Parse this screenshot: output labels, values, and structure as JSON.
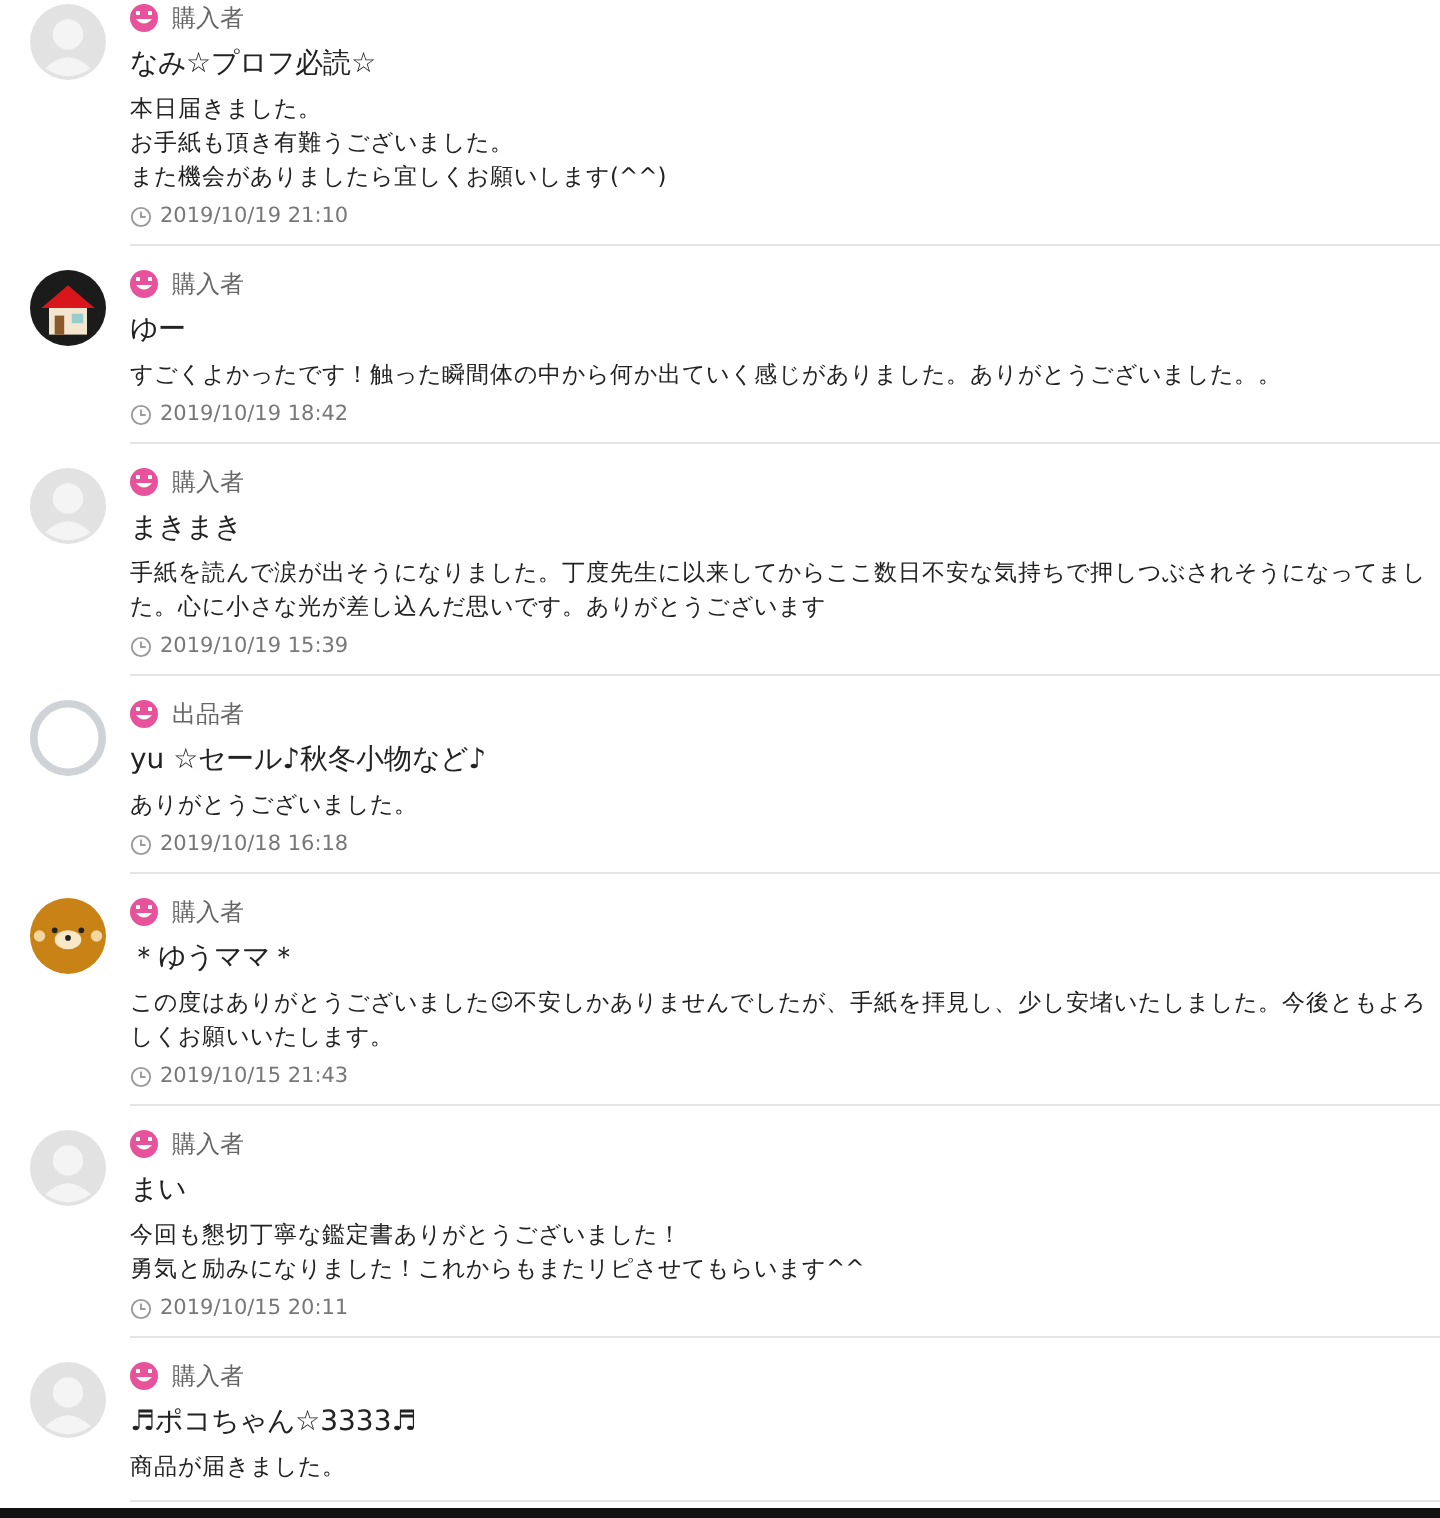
{
  "reviews": [
    {
      "kind": "default",
      "role": "購入者",
      "name": "なみ☆プロフ必読☆",
      "lines": [
        "本日届きました。",
        "お手紙も頂き有難うございました。",
        "また機会がありましたら宜しくお願いします(^^)"
      ],
      "time": "2019/10/19 21:10"
    },
    {
      "kind": "house",
      "role": "購入者",
      "name": "ゆー",
      "lines": [
        "すごくよかったです！触った瞬間体の中から何か出ていく感じがありました。ありがとうございました。。"
      ],
      "time": "2019/10/19 18:42"
    },
    {
      "kind": "default",
      "role": "購入者",
      "name": "まきまき",
      "lines": [
        "手紙を読んで涙が出そうになりました。丁度先生に以来してからここ数日不安な気持ちで押しつぶされそうになってました。心に小さな光が差し込んだ思いです。ありがとうございます"
      ],
      "time": "2019/10/19 15:39"
    },
    {
      "kind": "outline",
      "role": "出品者",
      "name": "yu ☆セール♪秋冬小物など♪",
      "lines": [
        "ありがとうございました。"
      ],
      "time": "2019/10/18 16:18"
    },
    {
      "kind": "bear",
      "role": "購入者",
      "name": "＊ゆうママ＊",
      "lines": [
        "この度はありがとうございました☺不安しかありませんでしたが、手紙を拝見し、少し安堵いたしました。今後ともよろしくお願いいたします。"
      ],
      "time": "2019/10/15 21:43"
    },
    {
      "kind": "default",
      "role": "購入者",
      "name": "まい",
      "lines": [
        "今回も懇切丁寧な鑑定書ありがとうございました！",
        "勇気と励みになりました！これからもまたリピさせてもらいます^^"
      ],
      "time": "2019/10/15 20:11"
    },
    {
      "kind": "default",
      "role": "購入者",
      "name": "♬ポコちゃん☆3333♬",
      "lines": [
        "商品が届きました。"
      ]
    }
  ]
}
